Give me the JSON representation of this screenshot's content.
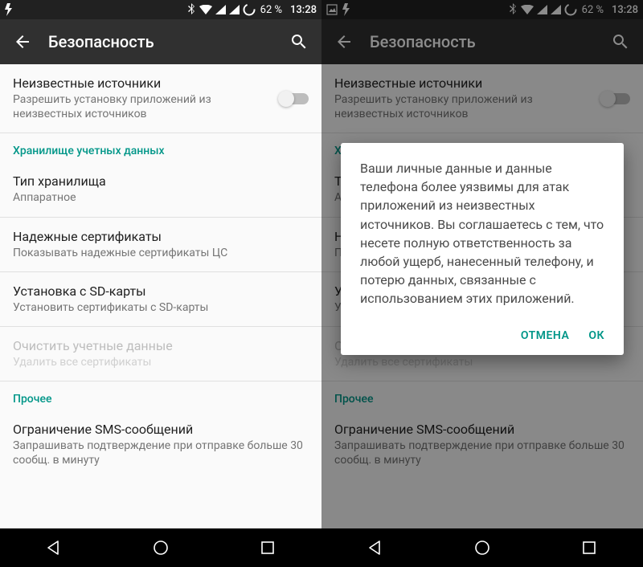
{
  "status": {
    "battery": "62 %",
    "time": "13:28"
  },
  "header": {
    "title": "Безопасность"
  },
  "settings": {
    "unknown_sources": {
      "title": "Неизвестные источники",
      "sub": "Разрешить установку приложений из неизвестных источников"
    },
    "section_credentials": "Хранилище учетных данных",
    "storage_type": {
      "title": "Тип хранилища",
      "sub": "Аппаратное"
    },
    "trusted_certs": {
      "title": "Надежные сертификаты",
      "sub": "Показывать надежные сертификаты ЦС"
    },
    "install_sd": {
      "title": "Установка с SD-карты",
      "sub": "Установить сертификаты с SD-карты"
    },
    "clear_creds": {
      "title": "Очистить учетные данные",
      "sub": "Удалить все сертификаты"
    },
    "section_other": "Прочее",
    "sms_limit": {
      "title": "Ограничение SMS-сообщений",
      "sub": "Запрашивать подтверждение при отправке больше 30 сообщ. в минуту"
    }
  },
  "dialog": {
    "body": "Ваши личные данные и данные телефона более уязвимы для атак приложений из неизвестных источников. Вы соглашаетесь с тем, что несете полную ответственность за любой ущерб, нанесенный телефону, и потерю данных, связанные с использованием этих приложений.",
    "cancel": "ОТМЕНА",
    "ok": "ОК"
  }
}
